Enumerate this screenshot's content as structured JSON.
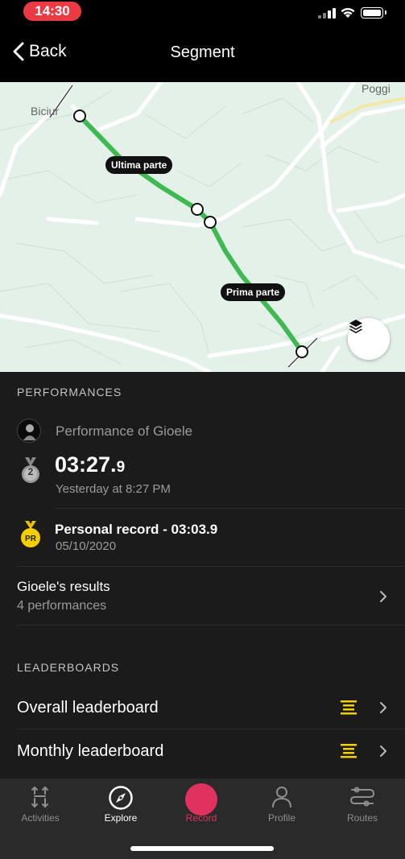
{
  "status_bar": {
    "time": "14:30"
  },
  "nav": {
    "back_label": "Back",
    "title": "Segment"
  },
  "map": {
    "labels": {
      "last_part": "Ultima parte",
      "first_part": "Prima parte"
    },
    "town_left": "Biciur",
    "town_right": "Poggi",
    "route_color": "#3fba52"
  },
  "performances": {
    "header": "PERFORMANCES",
    "performance_of": "Performance of Gioele",
    "time_main": "03:27.",
    "time_decimal": "9",
    "rank": "2",
    "when": "Yesterday at 8:27 PM",
    "pr_badge": "PR",
    "pr_title": "Personal record - 03:03.9",
    "pr_date": "05/10/2020",
    "results_title": "Gioele's results",
    "results_count": "4 performances"
  },
  "leaderboards": {
    "header": "LEADERBOARDS",
    "items": [
      {
        "label": "Overall leaderboard"
      },
      {
        "label": "Monthly leaderboard"
      }
    ]
  },
  "tabbar": {
    "tabs": [
      {
        "label": "Activities",
        "icon": "activities-icon"
      },
      {
        "label": "Explore",
        "icon": "compass-icon"
      },
      {
        "label": "Record",
        "icon": "record-icon"
      },
      {
        "label": "Profile",
        "icon": "person-icon"
      },
      {
        "label": "Routes",
        "icon": "routes-icon"
      }
    ],
    "active": "Explore",
    "record_color": "#e0315f"
  }
}
